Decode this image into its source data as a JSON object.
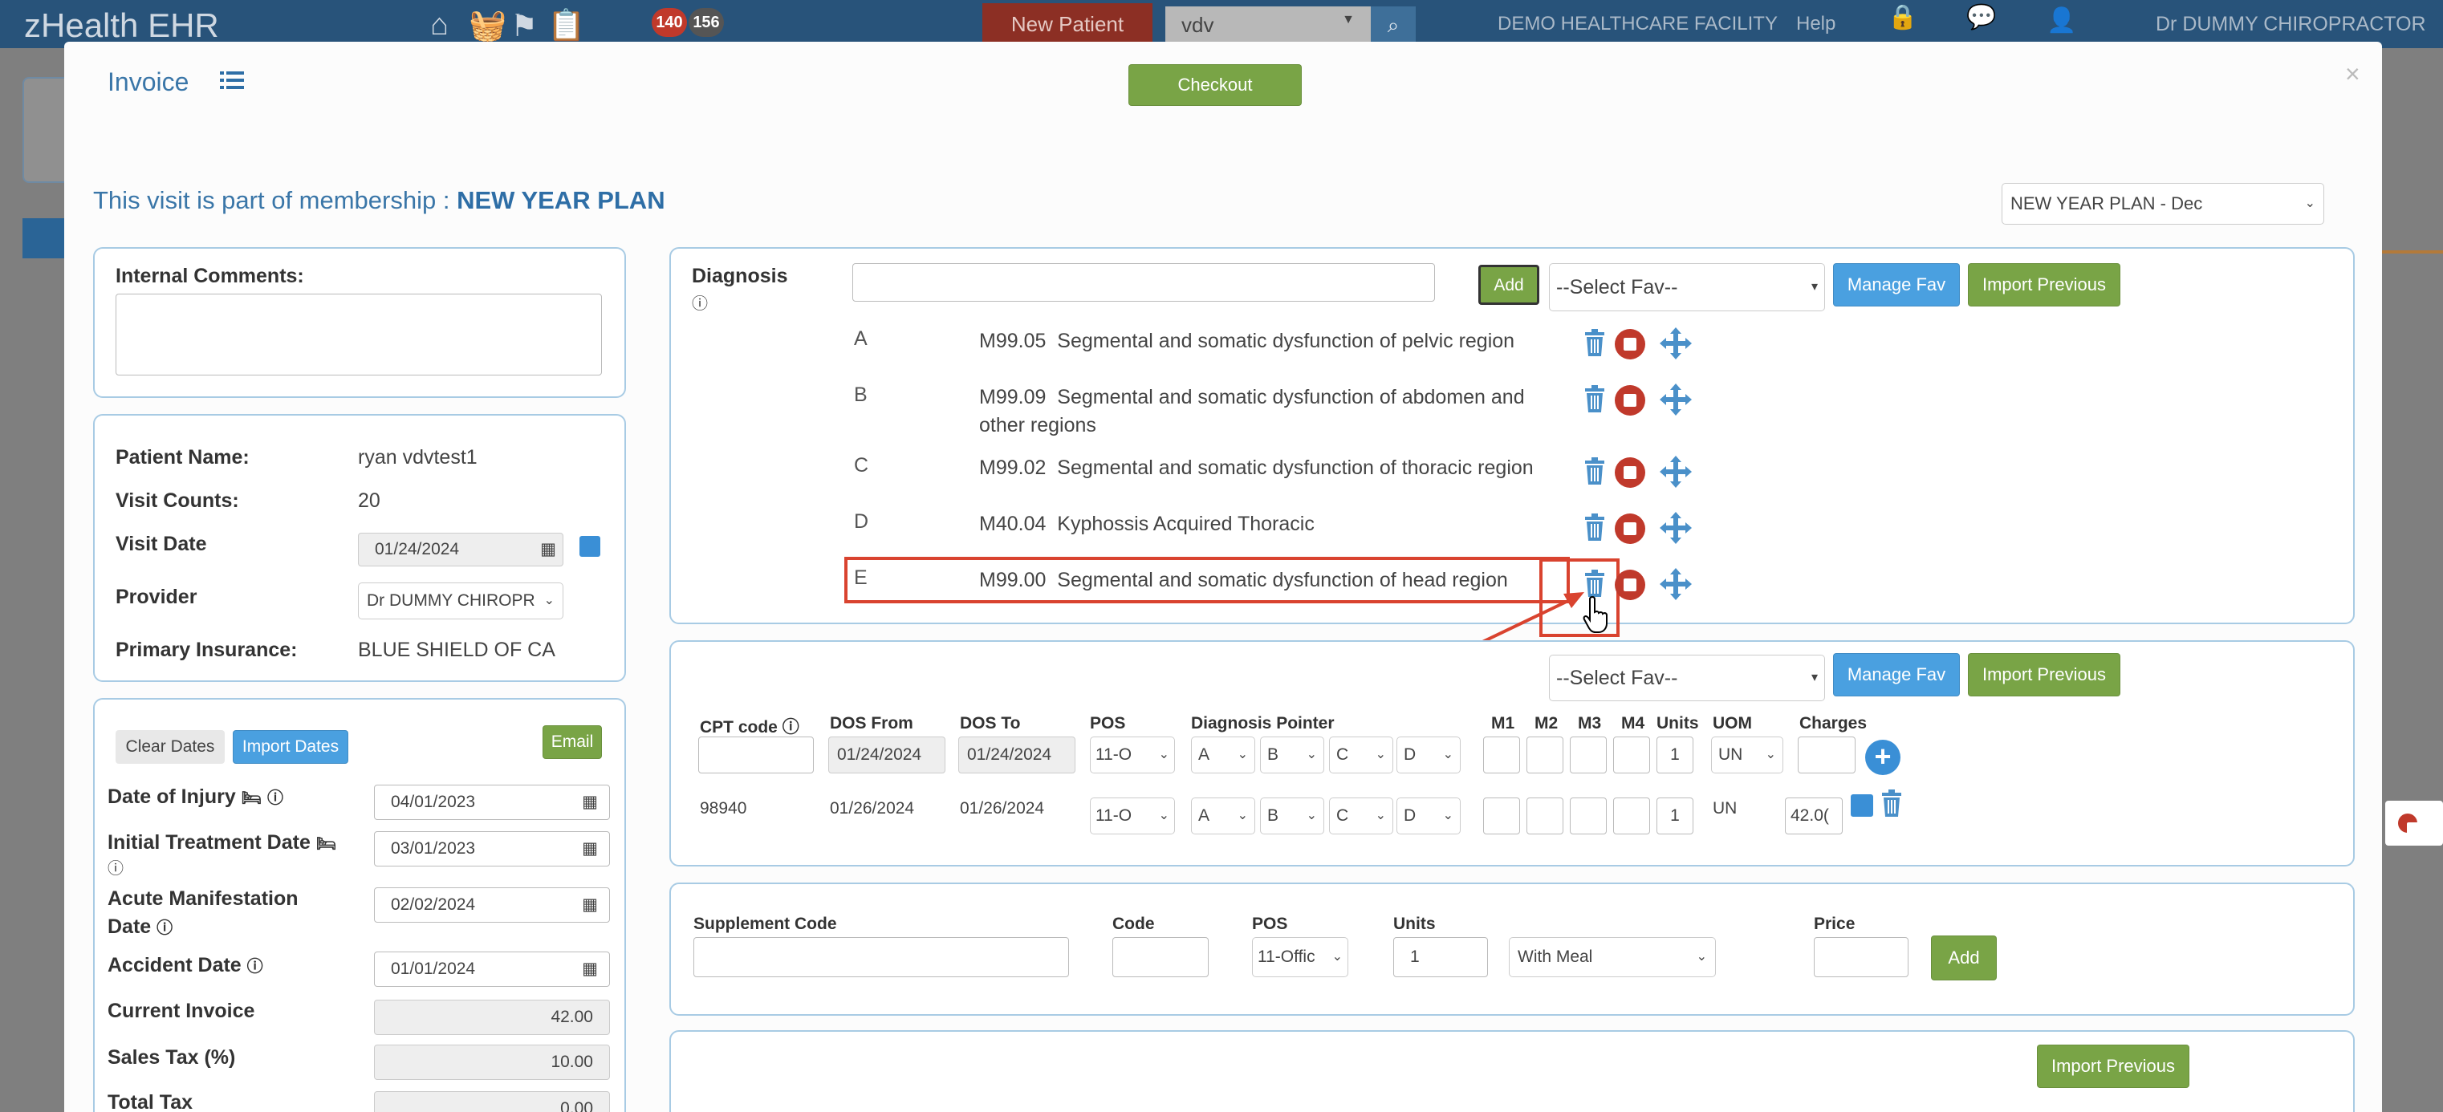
{
  "topbar": {
    "brand": "zHealth EHR",
    "badge1": "140",
    "badge2": "156",
    "new_patient": "New Patient",
    "search_value": "vdv",
    "facility": "DEMO HEALTHCARE FACILITY",
    "help": "Help",
    "user": "Dr DUMMY CHIROPRACTOR"
  },
  "modal": {
    "title": "Invoice",
    "checkout": "Checkout",
    "close": "×"
  },
  "membership": {
    "prefix": "This visit is part of membership : ",
    "plan": "NEW YEAR PLAN",
    "select_value": "NEW YEAR PLAN - Dec"
  },
  "comments": {
    "label": "Internal Comments:"
  },
  "patient": {
    "name_label": "Patient Name:",
    "name": "ryan vdvtest1",
    "visits_label": "Visit Counts:",
    "visits": "20",
    "date_label": "Visit Date",
    "date": "01/24/2024",
    "provider_label": "Provider",
    "provider": "Dr DUMMY CHIROPR",
    "insurance_label": "Primary Insurance:",
    "insurance": "BLUE SHIELD OF CA"
  },
  "dates": {
    "clear": "Clear Dates",
    "import": "Import Dates",
    "email": "Email",
    "injury_label": "Date of Injury",
    "injury": "04/01/2023",
    "initial_label": "Initial Treatment Date",
    "initial": "03/01/2023",
    "acute_label1": "Acute Manifestation",
    "acute_label2": "Date",
    "acute": "02/02/2024",
    "accident_label": "Accident Date",
    "accident": "01/01/2024",
    "invoice_label": "Current Invoice",
    "invoice": "42.00",
    "tax_label": "Sales Tax (%)",
    "tax": "10.00",
    "total_label": "Total Tax",
    "total": "0.00"
  },
  "diagnosis": {
    "label": "Diagnosis",
    "add": "Add",
    "fav": "--Select Fav--",
    "manage": "Manage Fav",
    "import": "Import Previous",
    "rows": [
      {
        "letter": "A",
        "code": "M99.05",
        "desc": "Segmental and somatic dysfunction of pelvic region"
      },
      {
        "letter": "B",
        "code": "M99.09",
        "desc": "Segmental and somatic dysfunction of abdomen and",
        "desc2": "other regions"
      },
      {
        "letter": "C",
        "code": "M99.02",
        "desc": "Segmental and somatic dysfunction of thoracic region"
      },
      {
        "letter": "D",
        "code": "M40.04",
        "desc": "Kyphossis Acquired Thoracic"
      },
      {
        "letter": "E",
        "code": "M99.00",
        "desc": "Segmental and somatic dysfunction of head region"
      }
    ]
  },
  "cpt": {
    "fav": "--Select Fav--",
    "manage": "Manage Fav",
    "import": "Import Previous",
    "headers": {
      "cpt": "CPT code",
      "from": "DOS From",
      "to": "DOS To",
      "pos": "POS",
      "pointer": "Diagnosis Pointer",
      "m1": "M1",
      "m2": "M2",
      "m3": "M3",
      "m4": "M4",
      "units": "Units",
      "uom": "UOM",
      "charges": "Charges"
    },
    "new": {
      "from": "01/24/2024",
      "to": "01/24/2024",
      "pos": "11-O",
      "p1": "A",
      "p2": "B",
      "p3": "C",
      "p4": "D",
      "units": "1",
      "uom": "UN"
    },
    "row": {
      "code": "98940",
      "from": "01/26/2024",
      "to": "01/26/2024",
      "pos": "11-O",
      "p1": "A",
      "p2": "B",
      "p3": "C",
      "p4": "D",
      "units": "1",
      "uom": "UN",
      "charges": "42.0("
    }
  },
  "supplement": {
    "code_label": "Supplement Code",
    "code2_label": "Code",
    "pos_label": "POS",
    "pos": "11-Offic",
    "units_label": "Units",
    "units": "1",
    "meal": "With Meal",
    "price_label": "Price",
    "add": "Add"
  },
  "misc": {
    "import": "Import Previous"
  }
}
